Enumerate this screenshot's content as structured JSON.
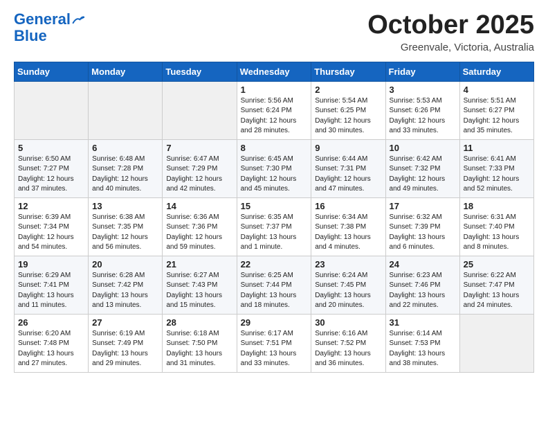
{
  "header": {
    "logo_line1": "General",
    "logo_line2": "Blue",
    "month_title": "October 2025",
    "location": "Greenvale, Victoria, Australia"
  },
  "days_of_week": [
    "Sunday",
    "Monday",
    "Tuesday",
    "Wednesday",
    "Thursday",
    "Friday",
    "Saturday"
  ],
  "weeks": [
    [
      {
        "num": "",
        "info": ""
      },
      {
        "num": "",
        "info": ""
      },
      {
        "num": "",
        "info": ""
      },
      {
        "num": "1",
        "info": "Sunrise: 5:56 AM\nSunset: 6:24 PM\nDaylight: 12 hours\nand 28 minutes."
      },
      {
        "num": "2",
        "info": "Sunrise: 5:54 AM\nSunset: 6:25 PM\nDaylight: 12 hours\nand 30 minutes."
      },
      {
        "num": "3",
        "info": "Sunrise: 5:53 AM\nSunset: 6:26 PM\nDaylight: 12 hours\nand 33 minutes."
      },
      {
        "num": "4",
        "info": "Sunrise: 5:51 AM\nSunset: 6:27 PM\nDaylight: 12 hours\nand 35 minutes."
      }
    ],
    [
      {
        "num": "5",
        "info": "Sunrise: 6:50 AM\nSunset: 7:27 PM\nDaylight: 12 hours\nand 37 minutes."
      },
      {
        "num": "6",
        "info": "Sunrise: 6:48 AM\nSunset: 7:28 PM\nDaylight: 12 hours\nand 40 minutes."
      },
      {
        "num": "7",
        "info": "Sunrise: 6:47 AM\nSunset: 7:29 PM\nDaylight: 12 hours\nand 42 minutes."
      },
      {
        "num": "8",
        "info": "Sunrise: 6:45 AM\nSunset: 7:30 PM\nDaylight: 12 hours\nand 45 minutes."
      },
      {
        "num": "9",
        "info": "Sunrise: 6:44 AM\nSunset: 7:31 PM\nDaylight: 12 hours\nand 47 minutes."
      },
      {
        "num": "10",
        "info": "Sunrise: 6:42 AM\nSunset: 7:32 PM\nDaylight: 12 hours\nand 49 minutes."
      },
      {
        "num": "11",
        "info": "Sunrise: 6:41 AM\nSunset: 7:33 PM\nDaylight: 12 hours\nand 52 minutes."
      }
    ],
    [
      {
        "num": "12",
        "info": "Sunrise: 6:39 AM\nSunset: 7:34 PM\nDaylight: 12 hours\nand 54 minutes."
      },
      {
        "num": "13",
        "info": "Sunrise: 6:38 AM\nSunset: 7:35 PM\nDaylight: 12 hours\nand 56 minutes."
      },
      {
        "num": "14",
        "info": "Sunrise: 6:36 AM\nSunset: 7:36 PM\nDaylight: 12 hours\nand 59 minutes."
      },
      {
        "num": "15",
        "info": "Sunrise: 6:35 AM\nSunset: 7:37 PM\nDaylight: 13 hours\nand 1 minute."
      },
      {
        "num": "16",
        "info": "Sunrise: 6:34 AM\nSunset: 7:38 PM\nDaylight: 13 hours\nand 4 minutes."
      },
      {
        "num": "17",
        "info": "Sunrise: 6:32 AM\nSunset: 7:39 PM\nDaylight: 13 hours\nand 6 minutes."
      },
      {
        "num": "18",
        "info": "Sunrise: 6:31 AM\nSunset: 7:40 PM\nDaylight: 13 hours\nand 8 minutes."
      }
    ],
    [
      {
        "num": "19",
        "info": "Sunrise: 6:29 AM\nSunset: 7:41 PM\nDaylight: 13 hours\nand 11 minutes."
      },
      {
        "num": "20",
        "info": "Sunrise: 6:28 AM\nSunset: 7:42 PM\nDaylight: 13 hours\nand 13 minutes."
      },
      {
        "num": "21",
        "info": "Sunrise: 6:27 AM\nSunset: 7:43 PM\nDaylight: 13 hours\nand 15 minutes."
      },
      {
        "num": "22",
        "info": "Sunrise: 6:25 AM\nSunset: 7:44 PM\nDaylight: 13 hours\nand 18 minutes."
      },
      {
        "num": "23",
        "info": "Sunrise: 6:24 AM\nSunset: 7:45 PM\nDaylight: 13 hours\nand 20 minutes."
      },
      {
        "num": "24",
        "info": "Sunrise: 6:23 AM\nSunset: 7:46 PM\nDaylight: 13 hours\nand 22 minutes."
      },
      {
        "num": "25",
        "info": "Sunrise: 6:22 AM\nSunset: 7:47 PM\nDaylight: 13 hours\nand 24 minutes."
      }
    ],
    [
      {
        "num": "26",
        "info": "Sunrise: 6:20 AM\nSunset: 7:48 PM\nDaylight: 13 hours\nand 27 minutes."
      },
      {
        "num": "27",
        "info": "Sunrise: 6:19 AM\nSunset: 7:49 PM\nDaylight: 13 hours\nand 29 minutes."
      },
      {
        "num": "28",
        "info": "Sunrise: 6:18 AM\nSunset: 7:50 PM\nDaylight: 13 hours\nand 31 minutes."
      },
      {
        "num": "29",
        "info": "Sunrise: 6:17 AM\nSunset: 7:51 PM\nDaylight: 13 hours\nand 33 minutes."
      },
      {
        "num": "30",
        "info": "Sunrise: 6:16 AM\nSunset: 7:52 PM\nDaylight: 13 hours\nand 36 minutes."
      },
      {
        "num": "31",
        "info": "Sunrise: 6:14 AM\nSunset: 7:53 PM\nDaylight: 13 hours\nand 38 minutes."
      },
      {
        "num": "",
        "info": ""
      }
    ]
  ]
}
